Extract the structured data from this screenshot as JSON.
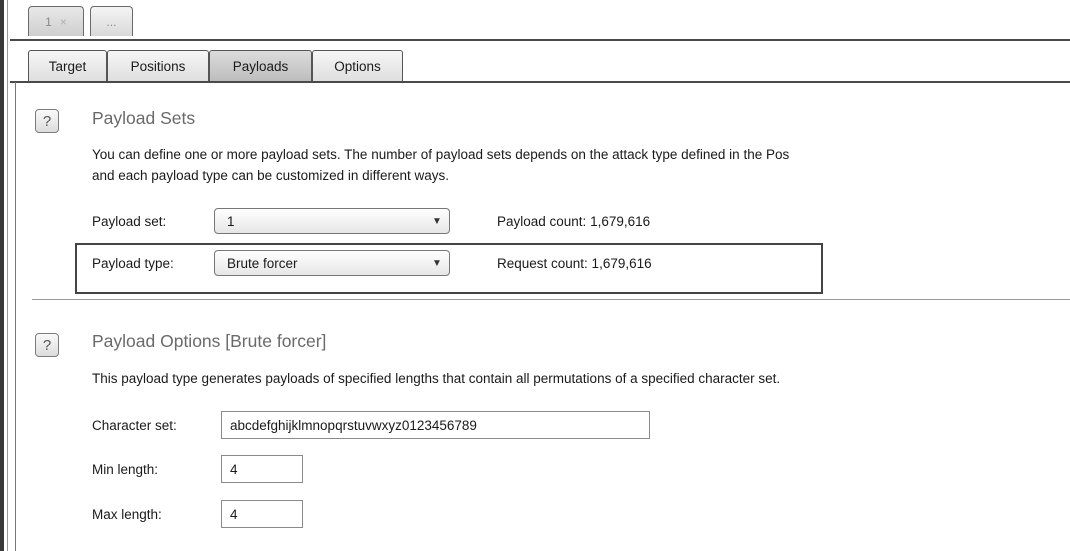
{
  "top_tabs": [
    {
      "label": "1",
      "close": "×"
    },
    {
      "label": "..."
    }
  ],
  "sub_tabs": [
    "Target",
    "Positions",
    "Payloads",
    "Options"
  ],
  "active_sub_tab": "Payloads",
  "payload_sets": {
    "help": "?",
    "title": "Payload Sets",
    "desc_line1": "You can define one or more payload sets. The number of payload sets depends on the attack type defined in the Pos",
    "desc_line2": "and each payload type can be customized in different ways.",
    "set_label": "Payload set:",
    "set_value": "1",
    "type_label": "Payload type:",
    "type_value": "Brute forcer",
    "payload_count": "Payload count:  1,679,616",
    "request_count": "Request count:  1,679,616"
  },
  "payload_options": {
    "help": "?",
    "title": "Payload Options [Brute forcer]",
    "desc": "This payload type generates payloads of specified lengths that contain all permutations of a specified character set.",
    "charset_label": "Character set:",
    "charset_value": "abcdefghijklmnopqrstuvwxyz0123456789",
    "min_label": "Min length:",
    "min_value": "4",
    "max_label": "Max length:",
    "max_value": "4"
  },
  "icons": {
    "dropdown": "chevron-down-icon",
    "help": "help-icon"
  }
}
